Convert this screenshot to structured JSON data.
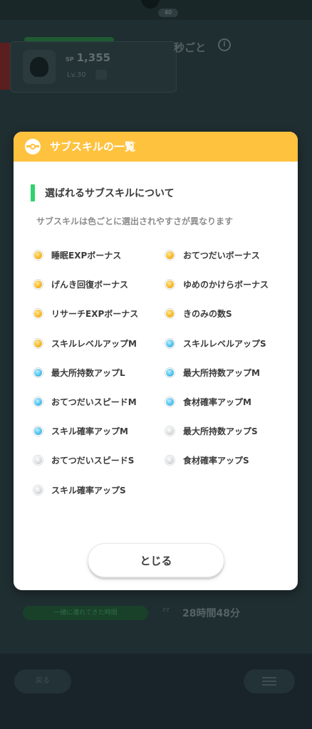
{
  "background": {
    "header_badge": "40",
    "every_text": "秒ごと",
    "info_icon": "info-icon",
    "card": {
      "sp_label": "SP",
      "sp_value": "1,355",
      "level": "Lv.30"
    },
    "green_pill": "一緒に連れてきた時間",
    "time_value": "28時間48分",
    "bottom_left": "戻る"
  },
  "modal": {
    "title": "サブスキルの一覧",
    "section_title": "選ばれるサブスキルについて",
    "section_description": "サブスキルは色ごとに選出されやすさが異なります",
    "colors": {
      "gold": "#f7b928",
      "blue": "#52c3ee",
      "white": "#d8dcde",
      "header": "#ffc23f",
      "accent": "#2fd36a"
    },
    "skills": [
      {
        "label": "睡眠EXPボーナス",
        "color": "gold"
      },
      {
        "label": "おてつだいボーナス",
        "color": "gold"
      },
      {
        "label": "げんき回復ボーナス",
        "color": "gold"
      },
      {
        "label": "ゆめのかけらボーナス",
        "color": "gold"
      },
      {
        "label": "リサーチEXPボーナス",
        "color": "gold"
      },
      {
        "label": "きのみの数S",
        "color": "gold"
      },
      {
        "label": "スキルレベルアップM",
        "color": "gold"
      },
      {
        "label": "スキルレベルアップS",
        "color": "blue"
      },
      {
        "label": "最大所持数アップL",
        "color": "blue"
      },
      {
        "label": "最大所持数アップM",
        "color": "blue"
      },
      {
        "label": "おてつだいスピードM",
        "color": "blue"
      },
      {
        "label": "食材確率アップM",
        "color": "blue"
      },
      {
        "label": "スキル確率アップM",
        "color": "blue"
      },
      {
        "label": "最大所持数アップS",
        "color": "white"
      },
      {
        "label": "おてつだいスピードS",
        "color": "white"
      },
      {
        "label": "食材確率アップS",
        "color": "white"
      },
      {
        "label": "スキル確率アップS",
        "color": "white"
      }
    ],
    "close_label": "とじる"
  }
}
